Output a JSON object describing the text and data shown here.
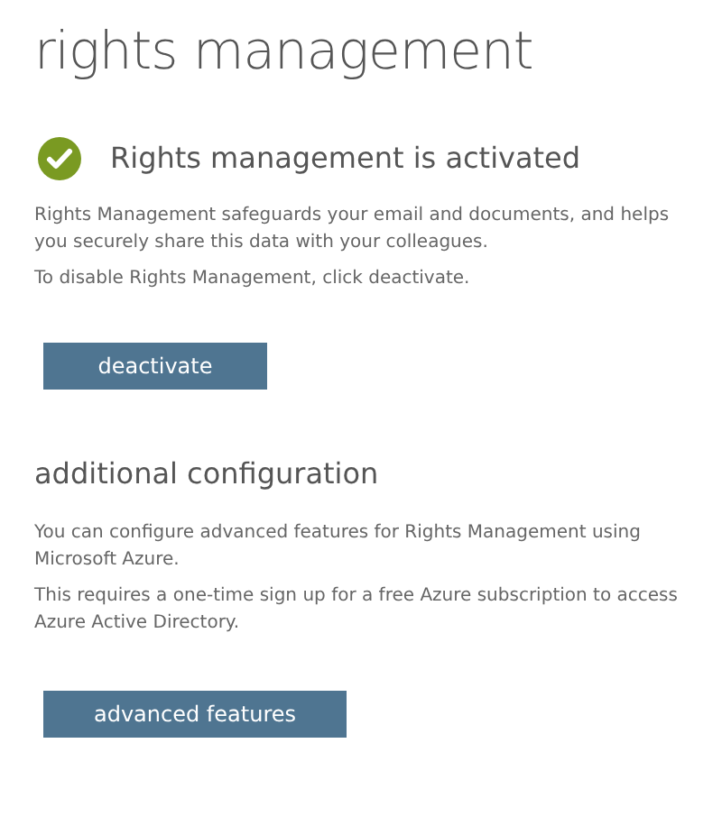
{
  "title": "rights management",
  "status": {
    "text": "Rights management is activated",
    "activated": true
  },
  "description": [
    "Rights Management safeguards your email and documents, and helps you securely share this data with your colleagues.",
    "To disable Rights Management, click deactivate."
  ],
  "primary_button": "deactivate",
  "additional": {
    "heading": "additional configuration",
    "paragraphs": [
      "You can configure advanced features for Rights Management using Microsoft Azure.",
      "This requires a one-time sign up for a free Azure subscription to access Azure Active Directory."
    ],
    "button": "advanced features"
  }
}
